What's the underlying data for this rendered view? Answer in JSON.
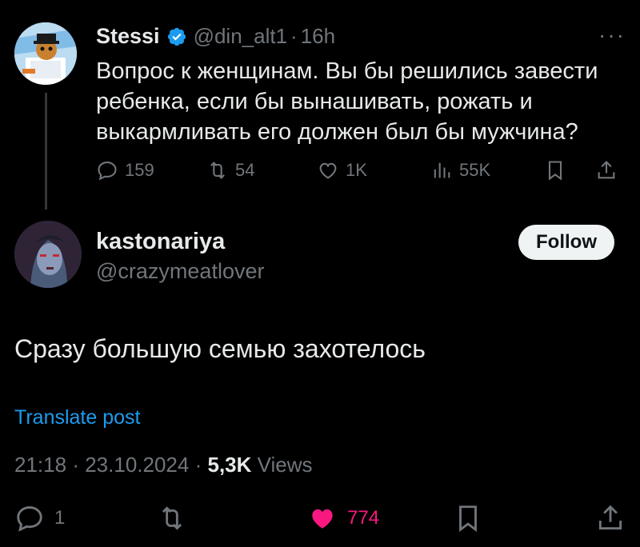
{
  "parent": {
    "author_name": "Stessi",
    "author_handle": "@din_alt1",
    "separator": "·",
    "time_ago": "16h",
    "more_label": "···",
    "text": "Вопрос к женщинам. Вы бы решились завести ребенка, если бы вынашивать, рожать и выкармливать его должен был бы мужчина?",
    "stats": {
      "replies": "159",
      "reposts": "54",
      "likes": "1K",
      "views": "55K"
    },
    "icons": [
      "verified-badge-icon",
      "reply-icon",
      "repost-icon",
      "like-icon",
      "views-icon",
      "bookmark-icon",
      "share-icon"
    ]
  },
  "reply": {
    "author_name": "kastonariya",
    "author_handle": "@crazymeatlover",
    "follow_label": "Follow",
    "text": "Сразу большую семью захотелось",
    "translate_label": "Translate post",
    "time": "21:18",
    "date": "23.10.2024",
    "separator": "·",
    "views_count": "5,3K",
    "views_label": "Views",
    "stats": {
      "replies": "1",
      "likes": "774"
    }
  },
  "colors": {
    "background": "#000000",
    "text": "#e7e9ea",
    "muted": "#71767b",
    "link": "#1d9bf0",
    "like_active": "#f91880",
    "verified": "#1d9bf0"
  }
}
